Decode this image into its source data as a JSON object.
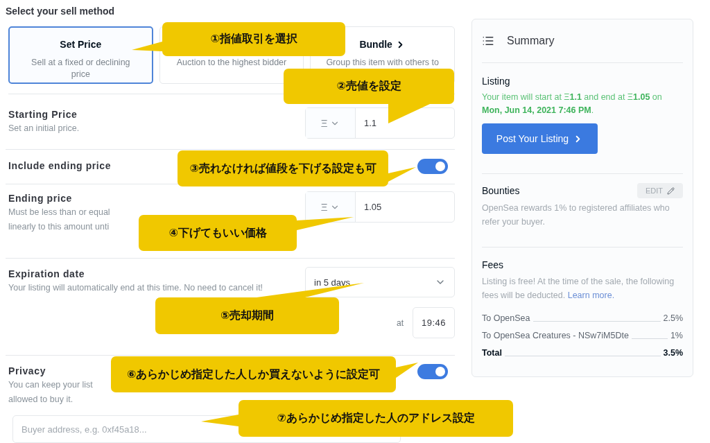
{
  "sell_method": {
    "title": "Select your sell method",
    "options": [
      {
        "kind": "fixed",
        "title": "Set Price",
        "description": "Sell at a fixed or declining price",
        "selected": true
      },
      {
        "kind": "auction",
        "description": "Auction to the highest bidder",
        "selected": false
      },
      {
        "kind": "bundle",
        "title": "Bundle",
        "description": "Group this item with others to",
        "selected": false
      }
    ]
  },
  "rows": [
    {
      "kind": "price",
      "label": "Starting Price",
      "description": [
        "Set an initial price."
      ],
      "currency": "Ξ",
      "value": "1.1"
    },
    {
      "kind": "toggle",
      "label": "Include ending price",
      "on": true
    },
    {
      "kind": "price",
      "label": "Ending price",
      "description": [
        "Must be less than or equal",
        "linearly to this amount unti"
      ],
      "currency": "Ξ",
      "value": "1.05"
    },
    {
      "kind": "date",
      "label": "Expiration date",
      "description": [
        "Your listing will automatically end at this time. No need to cancel it!"
      ],
      "duration": "in 5 days",
      "at_label": "at",
      "time": "19:46"
    },
    {
      "kind": "toggle",
      "label": "Privacy",
      "description": [
        "You can keep your list",
        "allowed to buy it."
      ],
      "on": true,
      "buyer_address": {
        "placeholder": "Buyer address, e.g. 0xf45a18..."
      }
    }
  ],
  "summary": {
    "title": "Summary",
    "listing": {
      "title": "Listing",
      "text": "Your item will start at Ξ**1.1** and end at Ξ**1.05** on **Mon, Jun 14, 2021 7:46 PM**.",
      "button": "Post Your Listing"
    },
    "bounties": {
      "title": "Bounties",
      "edit": "EDIT",
      "text": "OpenSea rewards 1% to registered affiliates who refer your buyer."
    },
    "fees": {
      "title": "Fees",
      "text": "Listing is free! At the time of the sale, the following fees will be deducted.",
      "link": "Learn more.",
      "rows": [
        {
          "kind": "fee",
          "label": "To OpenSea",
          "value": "2.5%"
        },
        {
          "kind": "fee",
          "label": "To OpenSea Creatures - NSw7iM5Dte",
          "value": "1%"
        },
        {
          "kind": "total",
          "label": "Total",
          "value": "3.5%"
        }
      ]
    }
  },
  "annotations": [
    {
      "text": "①指値取引を選択"
    },
    {
      "text": "②売値を設定"
    },
    {
      "text": "③売れなければ値段を下げる設定も可"
    },
    {
      "text": "④下げてもいい価格"
    },
    {
      "text": "⑤売却期間"
    },
    {
      "text": "⑥あらかじめ指定した人しか買えないように設定可"
    },
    {
      "text": "⑦あらかじめ指定した人のアドレス設定"
    }
  ]
}
